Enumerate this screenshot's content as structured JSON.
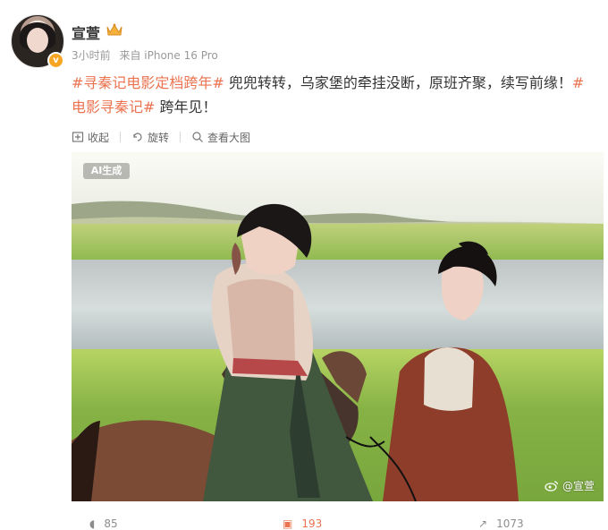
{
  "post": {
    "username": "宣萱",
    "meta": {
      "time": "3小时前",
      "source": "来自 iPhone 16 Pro"
    },
    "content": {
      "hashtag1": "#寻秦记电影定档跨年#",
      "text1": " 兜兜转转，乌家堡的牵挂没断，原班齐聚，续写前缘！",
      "hashtag2": "#电影寻秦记#",
      "text2": " 跨年见！"
    },
    "toolbar": {
      "collapse": "收起",
      "rotate": "旋转",
      "view_large": "查看大图"
    },
    "image": {
      "ai_label": "AI生成",
      "watermark": "@宣萱"
    },
    "actions": {
      "comment_count": "85",
      "like_count": "193",
      "share_count": "1073"
    }
  },
  "colors": {
    "hashtag": "#eb7350",
    "badge": "#f6a623"
  },
  "icons": {
    "crown": "crown-icon",
    "badge": "vip-badge-icon",
    "collapse": "collapse-icon",
    "rotate": "rotate-icon",
    "view": "search-image-icon",
    "comment": "comment-icon",
    "like": "like-icon",
    "share": "share-icon",
    "weibo": "weibo-icon"
  }
}
